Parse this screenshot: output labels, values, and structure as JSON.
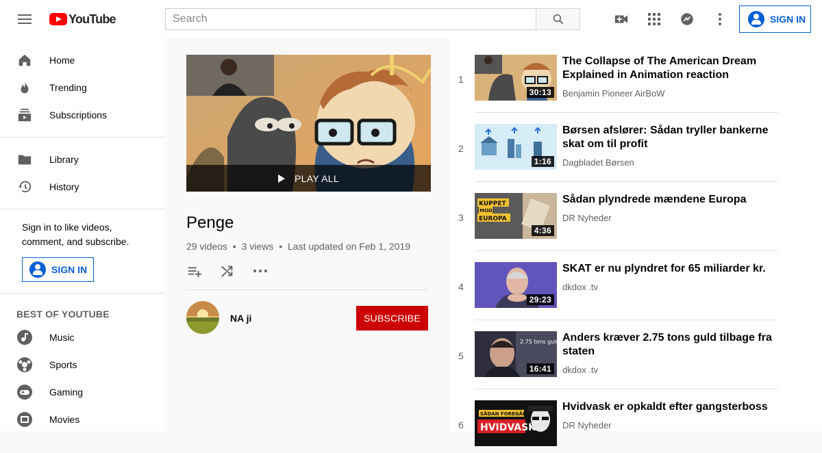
{
  "header": {
    "logo_text": "YouTube",
    "search_placeholder": "Search",
    "sign_in_label": "SIGN IN"
  },
  "sidebar": {
    "main": [
      {
        "label": "Home",
        "icon": "home-icon"
      },
      {
        "label": "Trending",
        "icon": "flame-icon"
      },
      {
        "label": "Subscriptions",
        "icon": "subscriptions-icon"
      }
    ],
    "library": [
      {
        "label": "Library",
        "icon": "folder-icon"
      },
      {
        "label": "History",
        "icon": "history-icon"
      }
    ],
    "signin_prompt": "Sign in to like videos, comment, and subscribe.",
    "signin_label": "SIGN IN",
    "best_of_heading": "BEST OF YOUTUBE",
    "best_of": [
      {
        "label": "Music",
        "icon": "music-icon"
      },
      {
        "label": "Sports",
        "icon": "sports-icon"
      },
      {
        "label": "Gaming",
        "icon": "gaming-icon"
      },
      {
        "label": "Movies",
        "icon": "movies-icon"
      }
    ]
  },
  "playlist": {
    "play_all_label": "PLAY ALL",
    "title": "Penge",
    "video_count": "29 videos",
    "views": "3 views",
    "updated": "Last updated on Feb 1, 2019",
    "owner": "NA ji",
    "subscribe_label": "SUBSCRIBE"
  },
  "videos": [
    {
      "index": "1",
      "title": "The Collapse of The American Dream Explained in Animation reaction",
      "channel": "Benjamin Pioneer AirBoW",
      "duration": "30:13"
    },
    {
      "index": "2",
      "title": "Børsen afslører: Sådan tryller bankerne skat om til profit",
      "channel": "Dagbladet Børsen",
      "duration": "1:16"
    },
    {
      "index": "3",
      "title": "Sådan plyndrede mændene Europa",
      "channel": "DR Nyheder",
      "duration": "4:36"
    },
    {
      "index": "4",
      "title": "SKAT er nu plyndret for 65 miliarder kr.",
      "channel": "dkdox .tv",
      "duration": "29:23"
    },
    {
      "index": "5",
      "title": "Anders kræver 2.75 tons guld tilbage fra staten",
      "channel": "dkdox .tv",
      "duration": "16:41"
    },
    {
      "index": "6",
      "title": "Hvidvask er opkaldt efter gangsterboss",
      "channel": "DR Nyheder",
      "duration": ""
    }
  ],
  "colors": {
    "brand_red": "#ff0000",
    "subscribe_red": "#cc0000",
    "link_blue": "#065fd4"
  }
}
